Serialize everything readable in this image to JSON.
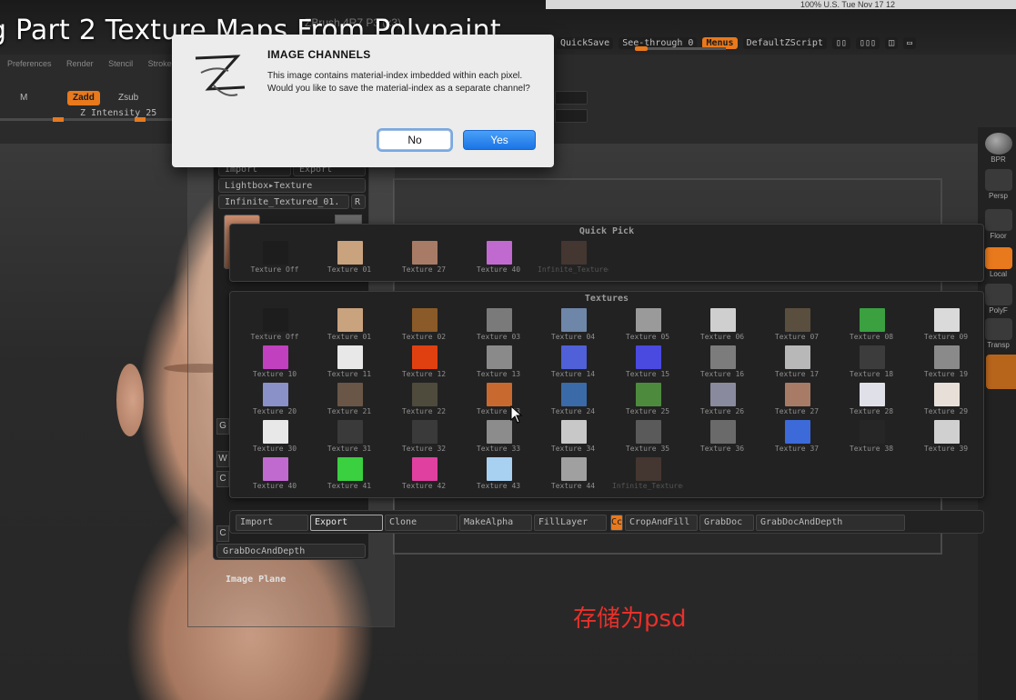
{
  "video_title": "g Part 2 Texture Maps From Polypaint",
  "app_title": "ZBrush 4R7 P3 (x3)",
  "mac_menubar": {
    "text": "100%  U.S.  Tue Nov 17  12"
  },
  "menu_row": [
    "Preferences",
    "Render",
    "Stencil",
    "Stroke"
  ],
  "top_toolbar": {
    "quicksave": "QuickSave",
    "see_through": "See-through 0",
    "menus": "Menus",
    "default_zscript": "DefaultZScript"
  },
  "modes": {
    "m": "M",
    "zadd": "Zadd",
    "zsub": "Zsub",
    "z_intensity": "Z Intensity 25"
  },
  "dialog": {
    "title": "IMAGE CHANNELS",
    "message": "This image contains material-index imbedded within each pixel. Would you like to save the material-index as a separate channel?",
    "no_label": "No",
    "yes_label": "Yes"
  },
  "subpalette": {
    "import": "Import",
    "export": "Export",
    "lightbox": "Lightbox▸Texture",
    "infinite": "Infinite_Textured_01.",
    "r_label": "R",
    "grabdoc_depth": "GrabDocAndDepth",
    "image_plane": "Image Plane",
    "side_letters": [
      "G",
      "W",
      "C",
      "C"
    ]
  },
  "quick_pick": {
    "header": "Quick Pick",
    "items": [
      {
        "label": "Texture Off",
        "color": "#1d1d1d"
      },
      {
        "label": "Texture 01",
        "color": "#c9a27e"
      },
      {
        "label": "Texture 27",
        "color": "#a87b66"
      },
      {
        "label": "Texture 40",
        "color": "#c06ad0"
      },
      {
        "label": "Infinite_Textured",
        "color": "#6e4f42",
        "dim": true
      }
    ]
  },
  "textures": {
    "header": "Textures",
    "items": [
      {
        "label": "Texture Off",
        "color": "#1d1d1d"
      },
      {
        "label": "Texture 01",
        "color": "#c9a27e"
      },
      {
        "label": "Texture 02",
        "color": "#8a5a28"
      },
      {
        "label": "Texture 03",
        "color": "#7a7a7a"
      },
      {
        "label": "Texture 04",
        "color": "#6e86a8"
      },
      {
        "label": "Texture 05",
        "color": "#9a9a9a"
      },
      {
        "label": "Texture 06",
        "color": "#cfcfcf"
      },
      {
        "label": "Texture 07",
        "color": "#5a4e3e"
      },
      {
        "label": "Texture 08",
        "color": "#3aa040"
      },
      {
        "label": "Texture 09",
        "color": "#dadada"
      },
      {
        "label": "Texture 10",
        "color": "#c040c0"
      },
      {
        "label": "Texture 11",
        "color": "#e8e8e8"
      },
      {
        "label": "Texture 12",
        "color": "#e04010"
      },
      {
        "label": "Texture 13",
        "color": "#8a8a8a"
      },
      {
        "label": "Texture 14",
        "color": "#5060d8"
      },
      {
        "label": "Texture 15",
        "color": "#4a4ae0"
      },
      {
        "label": "Texture 16",
        "color": "#7c7c7c"
      },
      {
        "label": "Texture 17",
        "color": "#b8b8b8"
      },
      {
        "label": "Texture 18",
        "color": "#3c3c3c"
      },
      {
        "label": "Texture 19",
        "color": "#8a8a8a"
      },
      {
        "label": "Texture 20",
        "color": "#8a90c8"
      },
      {
        "label": "Texture 21",
        "color": "#6a5646"
      },
      {
        "label": "Texture 22",
        "color": "#4e4a3c"
      },
      {
        "label": "Texture 23",
        "color": "#c86a30"
      },
      {
        "label": "Texture 24",
        "color": "#3a6aa8"
      },
      {
        "label": "Texture 25",
        "color": "#4e8a3e"
      },
      {
        "label": "Texture 26",
        "color": "#8a8a9e"
      },
      {
        "label": "Texture 27",
        "color": "#a87b66"
      },
      {
        "label": "Texture 28",
        "color": "#e0e0e8"
      },
      {
        "label": "Texture 29",
        "color": "#e8e0d8"
      },
      {
        "label": "Texture 30",
        "color": "#e8e8e8"
      },
      {
        "label": "Texture 31",
        "color": "#3a3a3a"
      },
      {
        "label": "Texture 32",
        "color": "#3a3a3a"
      },
      {
        "label": "Texture 33",
        "color": "#8c8c8c"
      },
      {
        "label": "Texture 34",
        "color": "#c8c8c8"
      },
      {
        "label": "Texture 35",
        "color": "#5a5a5a"
      },
      {
        "label": "Texture 36",
        "color": "#6a6a6a"
      },
      {
        "label": "Texture 37",
        "color": "#3c6ad8"
      },
      {
        "label": "Texture 38",
        "color": "#262626"
      },
      {
        "label": "Texture 39",
        "color": "#d0d0d0"
      },
      {
        "label": "Texture 40",
        "color": "#c06ad0"
      },
      {
        "label": "Texture 41",
        "color": "#3ad040"
      },
      {
        "label": "Texture 42",
        "color": "#e040a0"
      },
      {
        "label": "Texture 43",
        "color": "#a8d0f0"
      },
      {
        "label": "Texture 44",
        "color": "#a0a0a0"
      },
      {
        "label": "Infinite_Textured",
        "color": "#6e4f42",
        "dim": true
      }
    ]
  },
  "actions": {
    "import": "Import",
    "export": "Export",
    "clone": "Clone",
    "make_alpha": "MakeAlpha",
    "fill_layer": "FillLayer",
    "cc": "Cc",
    "crop_and_fill": "CropAndFill",
    "grab_doc": "GrabDoc",
    "grab_doc_depth": "GrabDocAndDepth"
  },
  "right_dock": {
    "bpr": "BPR",
    "persp": "Persp",
    "floor": "Floor",
    "local": "Local",
    "polyf": "PolyF",
    "transp": "Transp"
  },
  "annotation": "存储为psd",
  "colors": {
    "accent": "#e8791d",
    "dialog_yes": "#1a74e6"
  }
}
